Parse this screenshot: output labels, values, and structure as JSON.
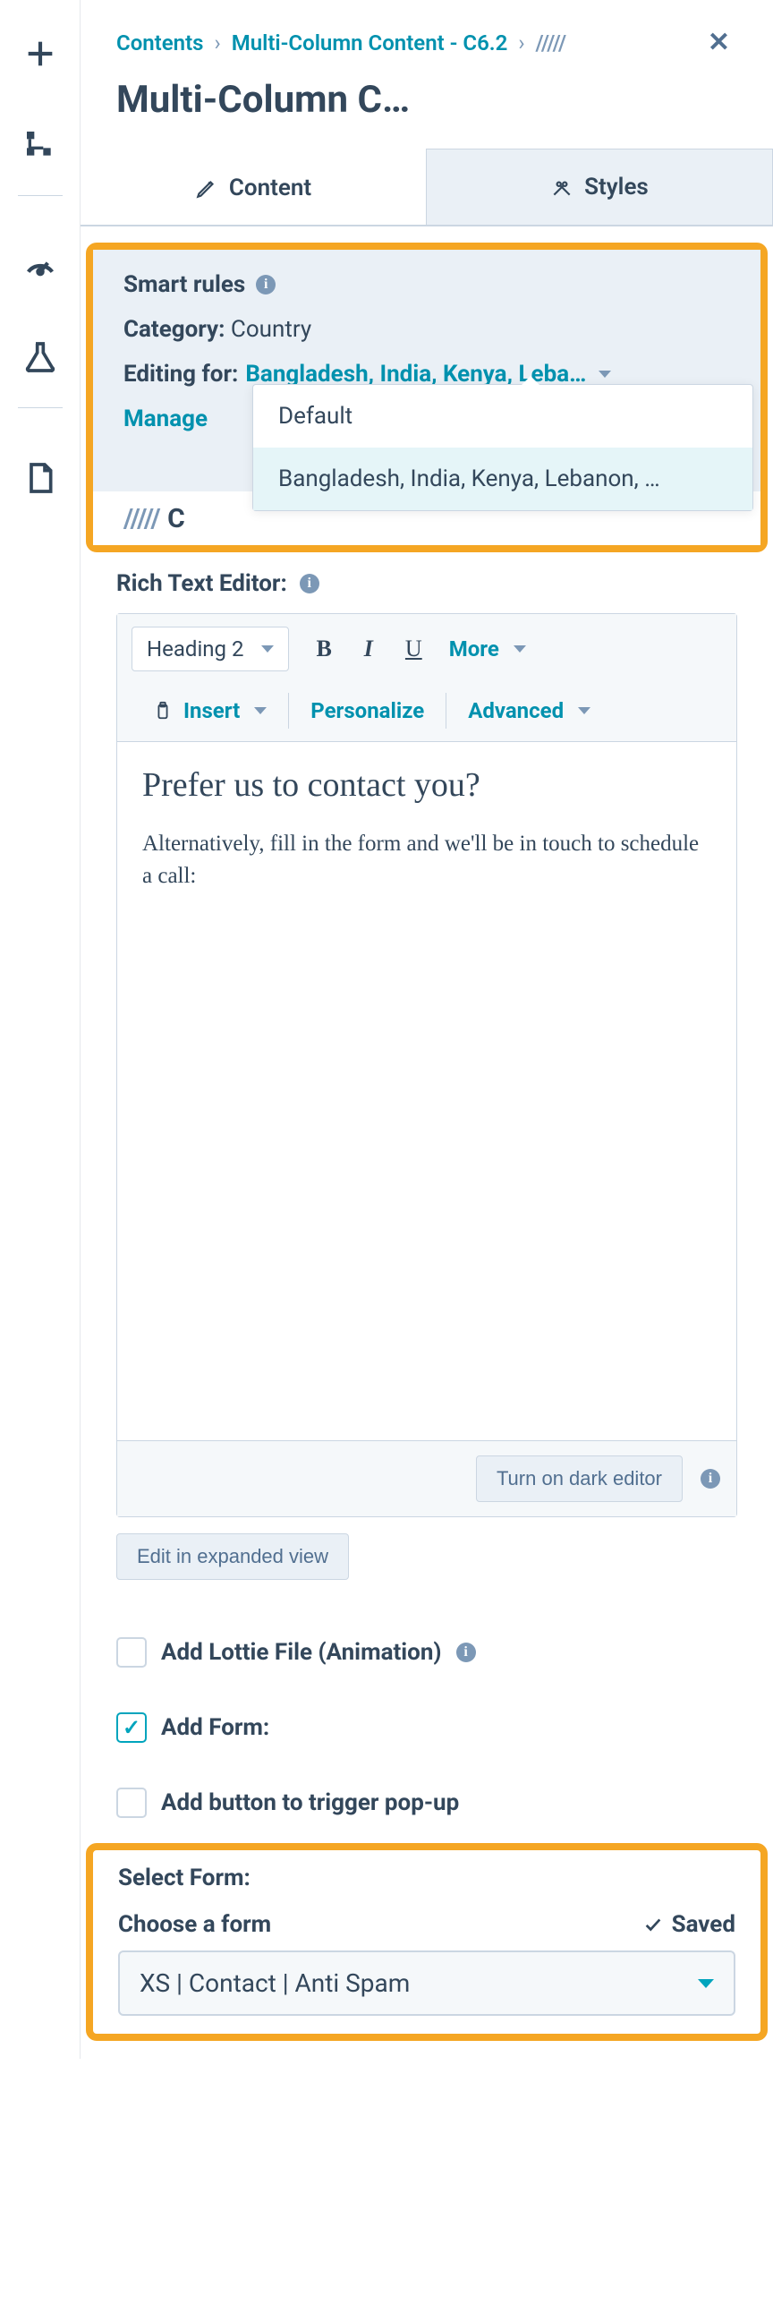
{
  "breadcrumb": {
    "root": "Contents",
    "module": "Multi-Column Content - C6.2",
    "slashes": "/////"
  },
  "title": "Multi-Column C…",
  "tabs": {
    "content": "Content",
    "styles": "Styles"
  },
  "smart_rules": {
    "heading": "Smart rules",
    "category_label": "Category:",
    "category_value": "Country",
    "editing_label": "Editing for:",
    "editing_value": "Bangladesh, India, Kenya, Leba…",
    "manage": "Manage",
    "dropdown": {
      "default": "Default",
      "selected": "Bangladesh, India, Kenya, Lebanon, …"
    }
  },
  "content_heading_prefix": "/////",
  "content_heading": "C",
  "rte": {
    "label": "Rich Text Editor:",
    "heading_select": "Heading 2",
    "more": "More",
    "insert": "Insert",
    "personalize": "Personalize",
    "advanced": "Advanced",
    "content_h2": "Prefer us to contact you?",
    "content_p": "Alternatively, fill in the form and we'll be in touch to schedule a call:",
    "dark_btn": "Turn on dark editor",
    "expanded_btn": "Edit in expanded view"
  },
  "checks": {
    "lottie": "Add Lottie File (Animation)",
    "add_form": "Add Form:",
    "popup": "Add button to trigger pop-up"
  },
  "select_form": {
    "title": "Select Form:",
    "choose": "Choose a form",
    "saved": "Saved",
    "value": "XS | Contact | Anti Spam"
  }
}
